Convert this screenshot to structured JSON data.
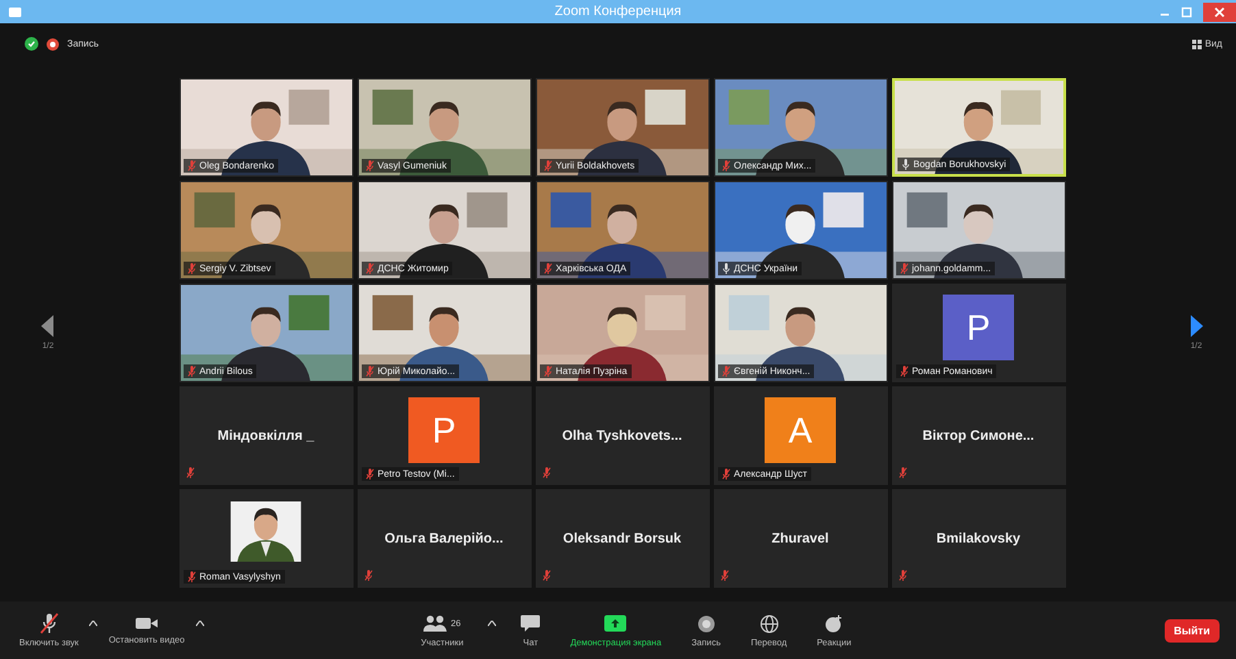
{
  "window": {
    "title": "Zoom Конференция"
  },
  "top_bar": {
    "recording_label": "Запись",
    "view_label": "Вид"
  },
  "pager": {
    "left": {
      "label": "1/2",
      "disabled": true
    },
    "right": {
      "label": "1/2",
      "disabled": false
    }
  },
  "tiles": [
    {
      "kind": "video",
      "name": "Oleg Bondarenko",
      "muted": true,
      "speaking": false
    },
    {
      "kind": "video",
      "name": "Vasyl Gumeniuk",
      "muted": true,
      "speaking": false
    },
    {
      "kind": "video",
      "name": "Yurii Boldakhovets",
      "muted": true,
      "speaking": false
    },
    {
      "kind": "video",
      "name": "Олександр Мих...",
      "muted": true,
      "speaking": false
    },
    {
      "kind": "video",
      "name": "Bogdan Borukhovskyi",
      "muted": false,
      "speaking": true
    },
    {
      "kind": "video",
      "name": "Sergiy V. Zibtsev",
      "muted": true,
      "speaking": false
    },
    {
      "kind": "video",
      "name": "ДСНС Житомир",
      "muted": true,
      "speaking": false
    },
    {
      "kind": "video",
      "name": "Харківська ОДА",
      "muted": true,
      "speaking": false
    },
    {
      "kind": "video",
      "name": "ДСНС України",
      "muted": false,
      "speaking": false
    },
    {
      "kind": "video",
      "name": "johann.goldamm...",
      "muted": true,
      "speaking": false
    },
    {
      "kind": "video",
      "name": "Andrii Bilous",
      "muted": true,
      "speaking": false
    },
    {
      "kind": "video",
      "name": "Юрій Миколайо...",
      "muted": true,
      "speaking": false
    },
    {
      "kind": "video",
      "name": "Наталія Пузріна",
      "muted": true,
      "speaking": false
    },
    {
      "kind": "video",
      "name": "Євгеній Никонч...",
      "muted": true,
      "speaking": false
    },
    {
      "kind": "avatar",
      "letter": "P",
      "color": "#5b5fc7",
      "name": "Роман Романович",
      "muted": true,
      "speaking": false
    },
    {
      "kind": "name",
      "name": "Міндовкілля _",
      "muted": true,
      "speaking": false
    },
    {
      "kind": "avatar",
      "letter": "P",
      "color": "#f05a22",
      "name": "Petro Testov (Mi...",
      "muted": true,
      "speaking": false
    },
    {
      "kind": "name",
      "name": "Olha Tyshkovets...",
      "muted": true,
      "speaking": false
    },
    {
      "kind": "avatar",
      "letter": "A",
      "color": "#f0801a",
      "name": "Александр Шуст",
      "muted": true,
      "speaking": false
    },
    {
      "kind": "name",
      "name": "Віктор Симоне...",
      "muted": true,
      "speaking": false
    },
    {
      "name": "Roman Vasylyshyn",
      "muted": true,
      "speaking": false
    },
    {
      "kind": "name",
      "name": "Ольга Валерійо...",
      "muted": true,
      "speaking": false
    },
    {
      "kind": "name",
      "name": "Oleksandr Borsuk",
      "muted": true,
      "speaking": false
    },
    {
      "kind": "name",
      "name": "Zhuravel",
      "muted": true,
      "speaking": false
    },
    {
      "kind": "name",
      "name": "Bmilakovsky",
      "muted": true,
      "speaking": false
    }
  ],
  "toolbar": {
    "left": [
      {
        "kind": "mic",
        "label": "Включить звук"
      },
      {
        "kind": "video",
        "label": "Остановить видео"
      }
    ],
    "center": [
      {
        "kind": "participants",
        "label": "Участники",
        "count": "26"
      },
      {
        "kind": "chat",
        "label": "Чат"
      },
      {
        "kind": "share",
        "label": "Демонстрация экрана"
      },
      {
        "kind": "record",
        "label": "Запись"
      },
      {
        "kind": "translate",
        "label": "Перевод"
      },
      {
        "kind": "reactions",
        "label": "Реакции"
      }
    ],
    "leave_button": "Выйти"
  }
}
